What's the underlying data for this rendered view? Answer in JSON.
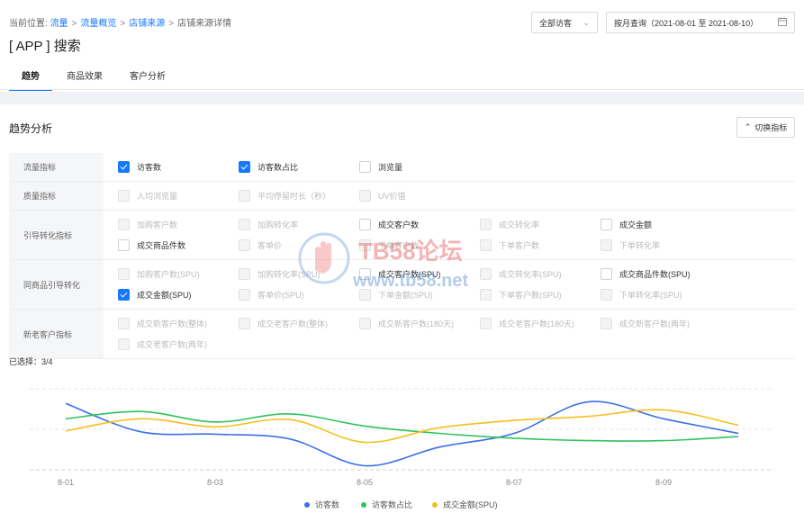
{
  "breadcrumb": {
    "prefix": "当前位置:",
    "items": [
      "流量",
      "流量概览",
      "店铺来源",
      "店铺来源详情"
    ],
    "separator": ">"
  },
  "page_title": "[ APP ] 搜索",
  "visitor_select": {
    "value": "全部访客"
  },
  "date_range": {
    "value": "按月查询（2021-08-01 至 2021-08-10）"
  },
  "tabs": [
    "趋势",
    "商品效果",
    "客户分析"
  ],
  "section_title": "趋势分析",
  "switch_label": "切换指标",
  "metric_groups": [
    {
      "label": "流量指标",
      "options": [
        {
          "label": "访客数",
          "checked": true,
          "disabled": false
        },
        {
          "label": "访客数占比",
          "checked": true,
          "disabled": false
        },
        {
          "label": "浏览量",
          "checked": false,
          "disabled": false
        }
      ]
    },
    {
      "label": "质量指标",
      "options": [
        {
          "label": "人均浏览量",
          "checked": false,
          "disabled": true
        },
        {
          "label": "平均停留时长（秒）",
          "checked": false,
          "disabled": true
        },
        {
          "label": "UV价值",
          "checked": false,
          "disabled": true
        }
      ]
    },
    {
      "label": "引导转化指标",
      "options": [
        {
          "label": "加购客户数",
          "checked": false,
          "disabled": true
        },
        {
          "label": "加购转化率",
          "checked": false,
          "disabled": true
        },
        {
          "label": "成交客户数",
          "checked": false,
          "disabled": false
        },
        {
          "label": "成交转化率",
          "checked": false,
          "disabled": true
        },
        {
          "label": "成交金额",
          "checked": false,
          "disabled": false
        },
        {
          "label": "成交商品件数",
          "checked": false,
          "disabled": false
        },
        {
          "label": "客单价",
          "checked": false,
          "disabled": true
        },
        {
          "label": "下单客户数",
          "checked": false,
          "disabled": true
        },
        {
          "label": "下单客户数",
          "checked": false,
          "disabled": true
        },
        {
          "label": "下单转化率",
          "checked": false,
          "disabled": true
        }
      ]
    },
    {
      "label": "同商品引导转化",
      "options": [
        {
          "label": "加购客户数(SPU)",
          "checked": false,
          "disabled": true
        },
        {
          "label": "加购转化率(SPU)",
          "checked": false,
          "disabled": true
        },
        {
          "label": "成交客户数(SPU)",
          "checked": false,
          "disabled": false
        },
        {
          "label": "成交转化率(SPU)",
          "checked": false,
          "disabled": true
        },
        {
          "label": "成交商品件数(SPU)",
          "checked": false,
          "disabled": false
        },
        {
          "label": "成交金额(SPU)",
          "checked": true,
          "disabled": false
        },
        {
          "label": "客单价(SPU)",
          "checked": false,
          "disabled": true
        },
        {
          "label": "下单金额(SPU)",
          "checked": false,
          "disabled": true
        },
        {
          "label": "下单客户数(SPU)",
          "checked": false,
          "disabled": true
        },
        {
          "label": "下单转化率(SPU)",
          "checked": false,
          "disabled": true
        }
      ]
    },
    {
      "label": "新老客户指标",
      "options": [
        {
          "label": "成交新客户数(整体)",
          "checked": false,
          "disabled": true
        },
        {
          "label": "成交老客户数(整体)",
          "checked": false,
          "disabled": true
        },
        {
          "label": "成交新客户数(180天)",
          "checked": false,
          "disabled": true
        },
        {
          "label": "成交老客户数(180天)",
          "checked": false,
          "disabled": true
        },
        {
          "label": "成交新客户数(两年)",
          "checked": false,
          "disabled": true
        },
        {
          "label": "成交老客户数(两年)",
          "checked": false,
          "disabled": true
        }
      ]
    }
  ],
  "selected_count": "已选择：3/4",
  "watermark": {
    "text": "TB58论坛",
    "url": "www.tb58.net"
  },
  "chart_data": {
    "type": "line",
    "x": [
      "8-01",
      "8-02",
      "8-03",
      "8-04",
      "8-05",
      "8-06",
      "8-07",
      "8-08",
      "8-09",
      "8-10"
    ],
    "x_tick_labels": [
      "8-01",
      "8-03",
      "8-05",
      "8-07",
      "8-09"
    ],
    "normalized": true,
    "ylim": [
      0,
      1
    ],
    "grid": true,
    "legend_position": "bottom",
    "series": [
      {
        "name": "访客数",
        "color": "#3b6fe6",
        "values": [
          0.82,
          0.47,
          0.44,
          0.38,
          0.05,
          0.28,
          0.45,
          0.84,
          0.63,
          0.45
        ]
      },
      {
        "name": "访客数占比",
        "color": "#2fc25b",
        "values": [
          0.63,
          0.72,
          0.59,
          0.69,
          0.54,
          0.45,
          0.39,
          0.36,
          0.36,
          0.41
        ]
      },
      {
        "name": "成交金额(SPU)",
        "color": "#f5bf1c",
        "values": [
          0.48,
          0.63,
          0.53,
          0.62,
          0.34,
          0.52,
          0.61,
          0.66,
          0.74,
          0.55
        ]
      }
    ]
  }
}
